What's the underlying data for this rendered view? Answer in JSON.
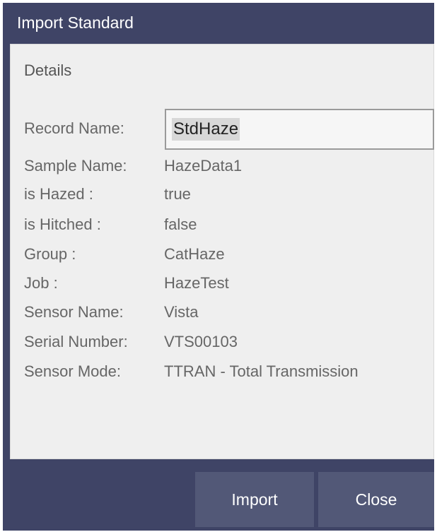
{
  "dialog": {
    "title": "Import Standard",
    "section_title": "Details"
  },
  "record": {
    "label": "Record Name:",
    "value": "StdHaze"
  },
  "details": [
    {
      "label": "Sample Name:",
      "value": "HazeData1"
    },
    {
      "label": "is Hazed :",
      "value": "true"
    },
    {
      "label": "is Hitched :",
      "value": "false"
    },
    {
      "label": "Group :",
      "value": "CatHaze"
    },
    {
      "label": "Job :",
      "value": "HazeTest"
    },
    {
      "label": "Sensor Name:",
      "value": "Vista"
    },
    {
      "label": "Serial Number:",
      "value": "VTS00103"
    },
    {
      "label": "Sensor Mode:",
      "value": "TTRAN - Total Transmission"
    }
  ],
  "buttons": {
    "import_label": "Import",
    "close_label": "Close"
  }
}
